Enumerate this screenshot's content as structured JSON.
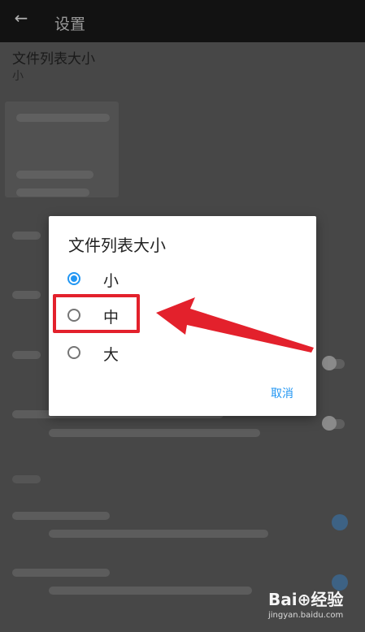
{
  "toolbar": {
    "title": "设置",
    "back_icon": "arrow-left-icon"
  },
  "settings": {
    "pref_title": "文件列表大小",
    "pref_value": "小"
  },
  "dialog": {
    "title": "文件列表大小",
    "options": [
      {
        "label": "小",
        "checked": true
      },
      {
        "label": "中",
        "checked": false
      },
      {
        "label": "大",
        "checked": false
      }
    ],
    "cancel_label": "取消"
  },
  "annotation": {
    "color": "#e3212c"
  },
  "watermark": {
    "logo": "Bai⊕经验",
    "url": "jingyan.baidu.com"
  },
  "accent_color": "#2196f3"
}
